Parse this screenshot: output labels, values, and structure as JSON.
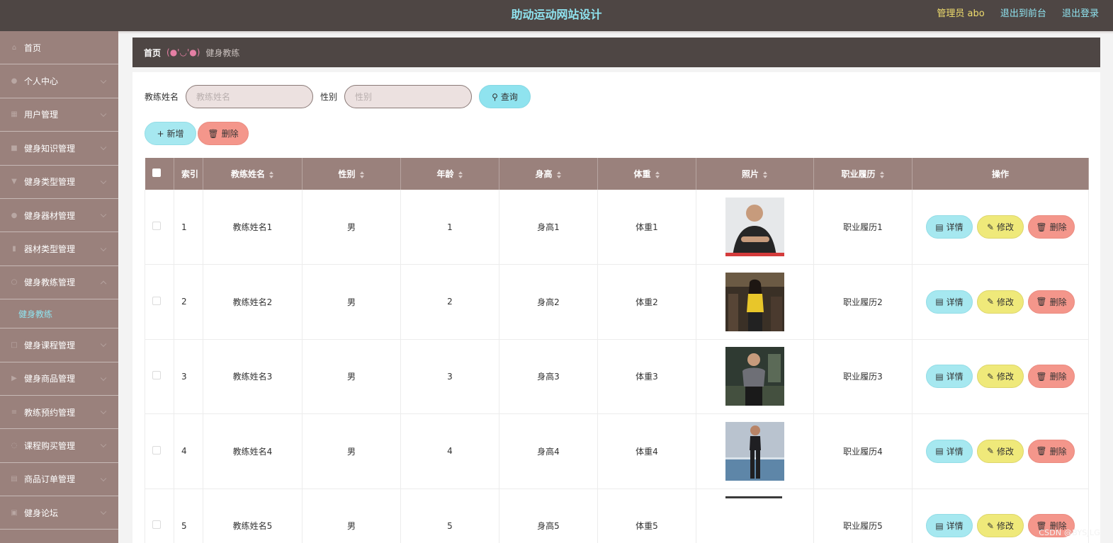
{
  "header": {
    "title": "助动运动网站设计",
    "admin_label": "管理员 abo",
    "back_front": "退出到前台",
    "logout": "退出登录"
  },
  "sidebar": {
    "items": [
      {
        "label": "首页",
        "icon": "home-icon"
      },
      {
        "label": "个人中心",
        "icon": "user-icon"
      },
      {
        "label": "用户管理",
        "icon": "grid-icon"
      },
      {
        "label": "健身知识管理",
        "icon": "book-icon"
      },
      {
        "label": "健身类型管理",
        "icon": "cup-icon"
      },
      {
        "label": "健身器材管理",
        "icon": "person-icon"
      },
      {
        "label": "器材类型管理",
        "icon": "bar-chart-icon"
      },
      {
        "label": "健身教练管理",
        "icon": "clock-icon"
      },
      {
        "label": "健身课程管理",
        "icon": "calendar-icon"
      },
      {
        "label": "健身商品管理",
        "icon": "flag-icon"
      },
      {
        "label": "教练预约管理",
        "icon": "list-icon"
      },
      {
        "label": "课程购买管理",
        "icon": "circle-icon"
      },
      {
        "label": "商品订单管理",
        "icon": "doc-icon"
      },
      {
        "label": "健身论坛",
        "icon": "chat-icon"
      }
    ],
    "active_sub": "健身教练"
  },
  "breadcrumb": {
    "home": "首页",
    "separator": "(●'◡'●)",
    "current": "健身教练"
  },
  "search": {
    "name_label": "教练姓名",
    "name_placeholder": "教练姓名",
    "gender_label": "性别",
    "gender_placeholder": "性别",
    "query_button": "查询"
  },
  "toolbar": {
    "add_button": "新增",
    "delete_button": "删除"
  },
  "table": {
    "headers": [
      "索引",
      "教练姓名",
      "性别",
      "年龄",
      "身高",
      "体重",
      "照片",
      "职业履历",
      "操作"
    ],
    "rows": [
      {
        "index": "1",
        "name": "教练姓名1",
        "gender": "男",
        "age": "1",
        "height": "身高1",
        "weight": "体重1",
        "career": "职业履历1"
      },
      {
        "index": "2",
        "name": "教练姓名2",
        "gender": "男",
        "age": "2",
        "height": "身高2",
        "weight": "体重2",
        "career": "职业履历2"
      },
      {
        "index": "3",
        "name": "教练姓名3",
        "gender": "男",
        "age": "3",
        "height": "身高3",
        "weight": "体重3",
        "career": "职业履历3"
      },
      {
        "index": "4",
        "name": "教练姓名4",
        "gender": "男",
        "age": "4",
        "height": "身高4",
        "weight": "体重4",
        "career": "职业履历4"
      },
      {
        "index": "5",
        "name": "教练姓名5",
        "gender": "男",
        "age": "5",
        "height": "身高5",
        "weight": "体重5",
        "career": "职业履历5"
      }
    ],
    "row_actions": {
      "detail": "详情",
      "edit": "修改",
      "delete": "删除"
    }
  },
  "watermark": "CSDN @BYSJLG"
}
